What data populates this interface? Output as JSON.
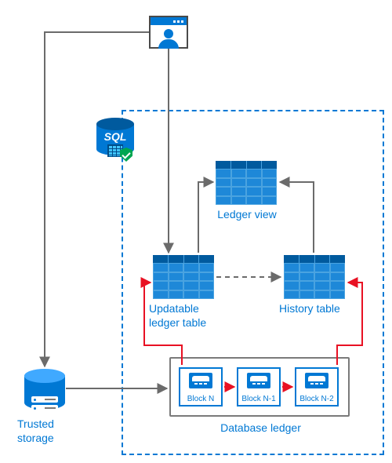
{
  "labels": {
    "ledger_view": "Ledger view",
    "updatable_l1": "Updatable",
    "updatable_l2": "ledger table",
    "history_table": "History table",
    "database_ledger": "Database ledger",
    "trusted_l1": "Trusted",
    "trusted_l2": "storage",
    "sql": "SQL"
  },
  "blocks": [
    {
      "label": "Block N"
    },
    {
      "label": "Block N-1"
    },
    {
      "label": "Block N-2"
    }
  ],
  "colors": {
    "azure_blue": "#0078d4",
    "dark_blue": "#005a9e",
    "grid_blue": "#2196e3",
    "arrow_gray": "#6b6b6b",
    "red": "#e81123"
  }
}
